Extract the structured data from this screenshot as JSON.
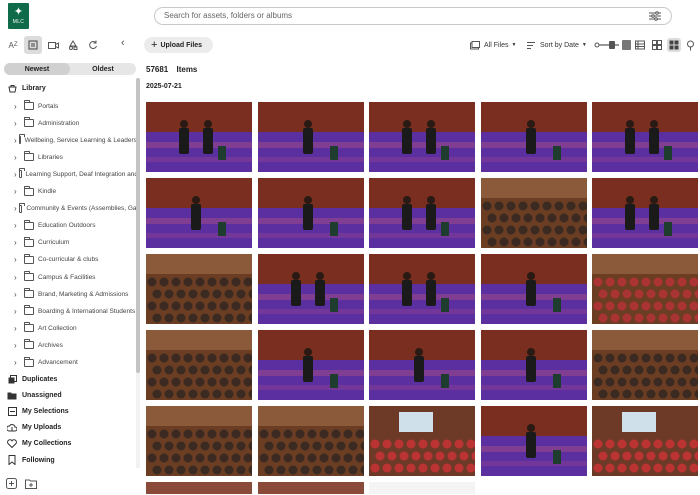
{
  "app": {
    "logo_text": "MLC"
  },
  "search": {
    "placeholder": "Search for assets, folders or albums"
  },
  "sidebar": {
    "sort_tabs": [
      "Newest",
      "Oldest"
    ],
    "library_label": "Library",
    "folders": [
      "Portals",
      "Administration",
      "Wellbeing, Service Learning & Leadership",
      "Libraries",
      "Learning Support, Deaf Integration and",
      "Kindle",
      "Community & Events (Assemblies, Gal",
      "Education Outdoors",
      "Curriculum",
      "Co-curricular & clubs",
      "Campus & Facilities",
      "Brand, Marketing & Admissions",
      "Boarding & International Students",
      "Art Collection",
      "Archives",
      "Advancement"
    ],
    "root_items": [
      {
        "label": "Duplicates",
        "icon": "duplicates-icon"
      },
      {
        "label": "Unassigned",
        "icon": "unassigned-icon"
      },
      {
        "label": "My Selections",
        "icon": "selections-icon"
      },
      {
        "label": "My Uploads",
        "icon": "upload-icon"
      },
      {
        "label": "My Collections",
        "icon": "heart-icon"
      },
      {
        "label": "Following",
        "icon": "bookmark-icon"
      }
    ]
  },
  "toolbar": {
    "upload_label": "Upload Files",
    "filter_label": "All Files",
    "sort_label": "Sort by Date"
  },
  "content": {
    "count": "57681",
    "count_label": "Items",
    "date_group": "2025-07-21"
  },
  "colors": {
    "brand": "#0f6b4a",
    "stage_purple": "#5b2fa0",
    "stage_wood": "#a0522d"
  }
}
